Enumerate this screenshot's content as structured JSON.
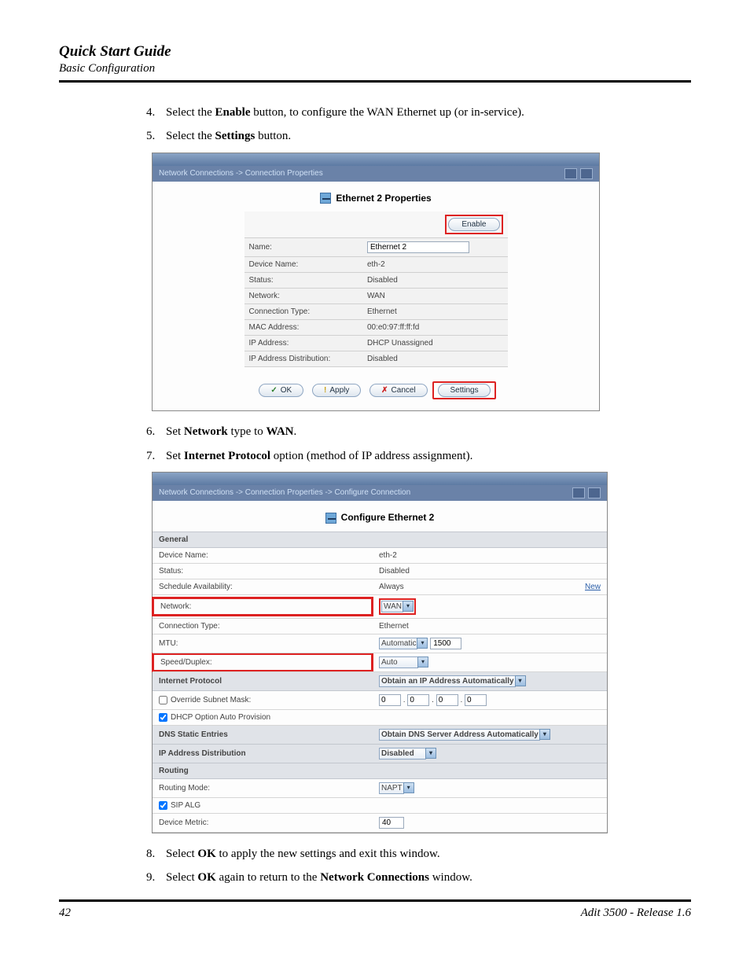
{
  "header": {
    "title": "Quick Start Guide",
    "subtitle": "Basic Configuration"
  },
  "footer": {
    "page": "42",
    "product": "Adit 3500  - Release 1.6"
  },
  "steps": {
    "s4a": "Select the ",
    "s4b": "Enable",
    "s4c": " button, to configure the WAN Ethernet up (or in-service).",
    "s5a": "Select the ",
    "s5b": "Settings",
    "s5c": " button.",
    "s6a": "Set ",
    "s6b": "Network",
    "s6c": " type to ",
    "s6d": "WAN",
    "s6e": ".",
    "s7a": "Set ",
    "s7b": "Internet Protocol",
    "s7c": " option (method of IP address assignment).",
    "s8a": "Select ",
    "s8b": "OK",
    "s8c": " to apply the new settings and exit this window.",
    "s9a": "Select ",
    "s9b": "OK",
    "s9c": " again to return to the ",
    "s9d": "Network Connections",
    "s9e": " window."
  },
  "shot1": {
    "breadcrumb": "Network Connections -> Connection Properties",
    "heading": "Ethernet 2 Properties",
    "enable_btn": "Enable",
    "rows": {
      "name_lbl": "Name:",
      "name_val": "Ethernet 2",
      "devname_lbl": "Device Name:",
      "devname_val": "eth-2",
      "status_lbl": "Status:",
      "status_val": "Disabled",
      "network_lbl": "Network:",
      "network_val": "WAN",
      "ctype_lbl": "Connection Type:",
      "ctype_val": "Ethernet",
      "mac_lbl": "MAC Address:",
      "mac_val": "00:e0:97:ff:ff:fd",
      "ip_lbl": "IP Address:",
      "ip_val": "DHCP Unassigned",
      "ipd_lbl": "IP Address Distribution:",
      "ipd_val": "Disabled"
    },
    "btns": {
      "ok": "OK",
      "apply": "Apply",
      "cancel": "Cancel",
      "settings": "Settings"
    }
  },
  "shot2": {
    "breadcrumb": "Network Connections -> Connection Properties -> Configure Connection",
    "heading": "Configure Ethernet 2",
    "sections": {
      "general": "General",
      "ip": "Internet Protocol",
      "dns": "DNS Static Entries",
      "ipd": "IP Address Distribution",
      "routing": "Routing"
    },
    "general": {
      "devname_lbl": "Device Name:",
      "devname_val": "eth-2",
      "status_lbl": "Status:",
      "status_val": "Disabled",
      "sched_lbl": "Schedule Availability:",
      "sched_val": "Always",
      "sched_new": "New",
      "network_lbl": "Network:",
      "network_val": "WAN",
      "ctype_lbl": "Connection Type:",
      "ctype_val": "Ethernet",
      "mtu_lbl": "MTU:",
      "mtu_sel": "Automatic",
      "mtu_val": "1500",
      "speed_lbl": "Speed/Duplex:",
      "speed_val": "Auto"
    },
    "ip": {
      "sel": "Obtain an IP Address Automatically",
      "override_lbl": "Override Subnet Mask:",
      "oct": [
        "0",
        "0",
        "0",
        "0"
      ],
      "dhcp_opt_lbl": "DHCP Option Auto Provision"
    },
    "dns": {
      "sel": "Obtain DNS Server Address Automatically"
    },
    "ipd": {
      "sel": "Disabled"
    },
    "routing": {
      "mode_lbl": "Routing Mode:",
      "mode_val": "NAPT",
      "sip_lbl": "SIP ALG",
      "metric_lbl": "Device Metric:",
      "metric_val": "40"
    }
  }
}
